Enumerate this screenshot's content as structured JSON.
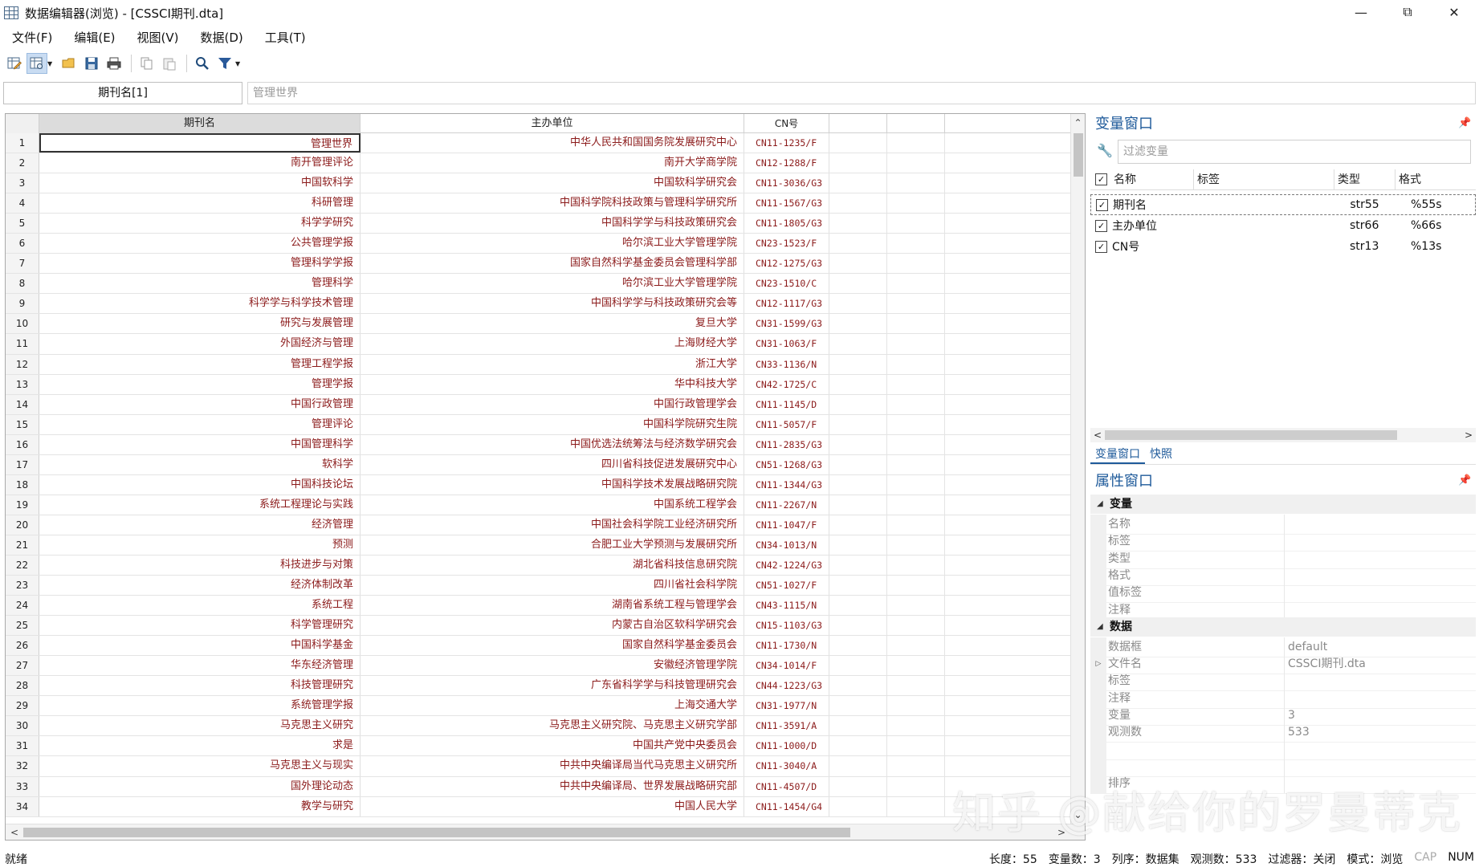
{
  "window": {
    "title": "数据编辑器(浏览) - [CSSCI期刊.dta]",
    "controls": [
      "minimize",
      "restore",
      "close"
    ]
  },
  "menu": [
    "文件(F)",
    "编辑(E)",
    "视图(V)",
    "数据(D)",
    "工具(T)"
  ],
  "toolbar": {
    "icons": [
      "edit-mode-icon",
      "browse-mode-icon",
      "open-folder-icon",
      "save-icon",
      "print-icon",
      "copy-icon",
      "paste-icon",
      "find-icon",
      "filter-icon"
    ]
  },
  "varbar": {
    "current_cell": "期刊名[1]",
    "current_value": "管理世界"
  },
  "grid": {
    "columns": [
      "期刊名",
      "主办单位",
      "CN号"
    ],
    "rows": [
      {
        "n": "1",
        "name": "管理世界",
        "org": "中华人民共和国国务院发展研究中心",
        "cn": "CN11-1235/F"
      },
      {
        "n": "2",
        "name": "南开管理评论",
        "org": "南开大学商学院",
        "cn": "CN12-1288/F"
      },
      {
        "n": "3",
        "name": "中国软科学",
        "org": "中国软科学研究会",
        "cn": "CN11-3036/G3"
      },
      {
        "n": "4",
        "name": "科研管理",
        "org": "中国科学院科技政策与管理科学研究所",
        "cn": "CN11-1567/G3"
      },
      {
        "n": "5",
        "name": "科学学研究",
        "org": "中国科学学与科技政策研究会",
        "cn": "CN11-1805/G3"
      },
      {
        "n": "6",
        "name": "公共管理学报",
        "org": "哈尔滨工业大学管理学院",
        "cn": "CN23-1523/F"
      },
      {
        "n": "7",
        "name": "管理科学学报",
        "org": "国家自然科学基金委员会管理科学部",
        "cn": "CN12-1275/G3"
      },
      {
        "n": "8",
        "name": "管理科学",
        "org": "哈尔滨工业大学管理学院",
        "cn": "CN23-1510/C"
      },
      {
        "n": "9",
        "name": "科学学与科学技术管理",
        "org": "中国科学学与科技政策研究会等",
        "cn": "CN12-1117/G3"
      },
      {
        "n": "10",
        "name": "研究与发展管理",
        "org": "复旦大学",
        "cn": "CN31-1599/G3"
      },
      {
        "n": "11",
        "name": "外国经济与管理",
        "org": "上海财经大学",
        "cn": "CN31-1063/F"
      },
      {
        "n": "12",
        "name": "管理工程学报",
        "org": "浙江大学",
        "cn": "CN33-1136/N"
      },
      {
        "n": "13",
        "name": "管理学报",
        "org": "华中科技大学",
        "cn": "CN42-1725/C"
      },
      {
        "n": "14",
        "name": "中国行政管理",
        "org": "中国行政管理学会",
        "cn": "CN11-1145/D"
      },
      {
        "n": "15",
        "name": "管理评论",
        "org": "中国科学院研究生院",
        "cn": "CN11-5057/F"
      },
      {
        "n": "16",
        "name": "中国管理科学",
        "org": "中国优选法统筹法与经济数学研究会",
        "cn": "CN11-2835/G3"
      },
      {
        "n": "17",
        "name": "软科学",
        "org": "四川省科技促进发展研究中心",
        "cn": "CN51-1268/G3"
      },
      {
        "n": "18",
        "name": "中国科技论坛",
        "org": "中国科学技术发展战略研究院",
        "cn": "CN11-1344/G3"
      },
      {
        "n": "19",
        "name": "系统工程理论与实践",
        "org": "中国系统工程学会",
        "cn": "CN11-2267/N"
      },
      {
        "n": "20",
        "name": "经济管理",
        "org": "中国社会科学院工业经济研究所",
        "cn": "CN11-1047/F"
      },
      {
        "n": "21",
        "name": "预测",
        "org": "合肥工业大学预测与发展研究所",
        "cn": "CN34-1013/N"
      },
      {
        "n": "22",
        "name": "科技进步与对策",
        "org": "湖北省科技信息研究院",
        "cn": "CN42-1224/G3"
      },
      {
        "n": "23",
        "name": "经济体制改革",
        "org": "四川省社会科学院",
        "cn": "CN51-1027/F"
      },
      {
        "n": "24",
        "name": "系统工程",
        "org": "湖南省系统工程与管理学会",
        "cn": "CN43-1115/N"
      },
      {
        "n": "25",
        "name": "科学管理研究",
        "org": "内蒙古自治区软科学研究会",
        "cn": "CN15-1103/G3"
      },
      {
        "n": "26",
        "name": "中国科学基金",
        "org": "国家自然科学基金委员会",
        "cn": "CN11-1730/N"
      },
      {
        "n": "27",
        "name": "华东经济管理",
        "org": "安徽经济管理学院",
        "cn": "CN34-1014/F"
      },
      {
        "n": "28",
        "name": "科技管理研究",
        "org": "广东省科学学与科技管理研究会",
        "cn": "CN44-1223/G3"
      },
      {
        "n": "29",
        "name": "系统管理学报",
        "org": "上海交通大学",
        "cn": "CN31-1977/N"
      },
      {
        "n": "30",
        "name": "马克思主义研究",
        "org": "马克思主义研究院、马克思主义研究学部",
        "cn": "CN11-3591/A"
      },
      {
        "n": "31",
        "name": "求是",
        "org": "中国共产党中央委员会",
        "cn": "CN11-1000/D"
      },
      {
        "n": "32",
        "name": "马克思主义与现实",
        "org": "中共中央编译局当代马克思主义研究所",
        "cn": "CN11-3040/A"
      },
      {
        "n": "33",
        "name": "国外理论动态",
        "org": "中共中央编译局、世界发展战略研究部",
        "cn": "CN11-4507/D"
      },
      {
        "n": "34",
        "name": "教学与研究",
        "org": "中国人民大学",
        "cn": "CN11-1454/G4"
      }
    ]
  },
  "var_window": {
    "title": "变量窗口",
    "filter_placeholder": "过滤变量",
    "headers": [
      "名称",
      "标签",
      "类型",
      "格式"
    ],
    "vars": [
      {
        "name": "期刊名",
        "type": "str55",
        "format": "%55s"
      },
      {
        "name": "主办单位",
        "type": "str66",
        "format": "%66s"
      },
      {
        "name": "CN号",
        "type": "str13",
        "format": "%13s"
      }
    ],
    "tabs": [
      "变量窗口",
      "快照"
    ]
  },
  "prop_window": {
    "title": "属性窗口",
    "sections": [
      {
        "title": "变量",
        "rows": [
          {
            "key": "名称",
            "value": ""
          },
          {
            "key": "标签",
            "value": ""
          },
          {
            "key": "类型",
            "value": ""
          },
          {
            "key": "格式",
            "value": ""
          },
          {
            "key": "值标签",
            "value": ""
          },
          {
            "key": "注释",
            "value": ""
          }
        ]
      },
      {
        "title": "数据",
        "rows": [
          {
            "key": "数据框",
            "value": "default"
          },
          {
            "key": "文件名",
            "value": "CSSCI期刊.dta"
          },
          {
            "key": "标签",
            "value": ""
          },
          {
            "key": "注释",
            "value": ""
          },
          {
            "key": "变量",
            "value": "3"
          },
          {
            "key": "观测数",
            "value": "533"
          },
          {
            "key": "",
            "value": ""
          },
          {
            "key": "",
            "value": ""
          },
          {
            "key": "排序",
            "value": ""
          }
        ]
      }
    ]
  },
  "status": {
    "left": "就绪",
    "length": "长度：55",
    "varcount": "变量数：3",
    "order": "列序：数据集",
    "obs": "观测数：533",
    "filter": "过滤器：关闭",
    "mode": "模式：浏览",
    "cap": "CAP",
    "num": "NUM"
  },
  "watermark": "知乎 @献给你的罗曼蒂克"
}
